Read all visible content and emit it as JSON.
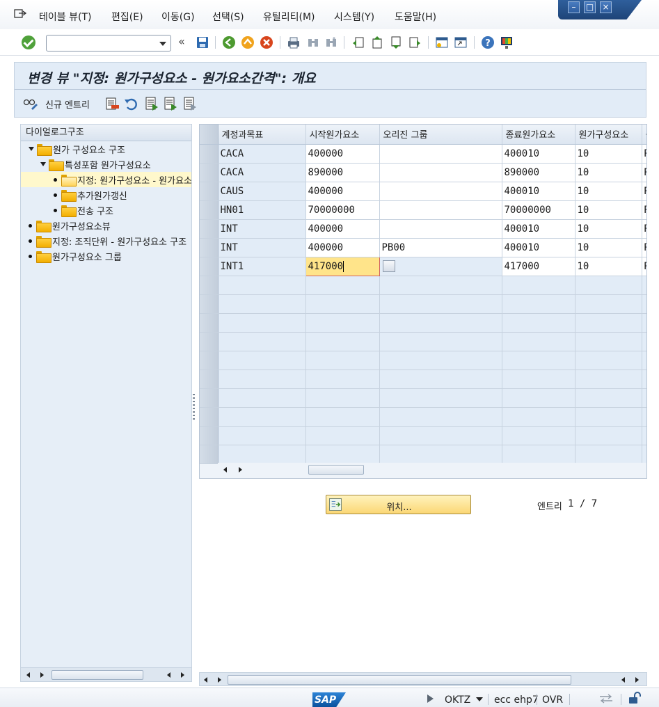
{
  "menu": {
    "items": [
      "테이블 뷰(T)",
      "편집(E)",
      "이동(G)",
      "선택(S)",
      "유틸리티(M)",
      "시스템(Y)",
      "도움말(H)"
    ]
  },
  "window_controls": [
    "minimize",
    "restore",
    "close"
  ],
  "toolbar": {
    "command_value": "",
    "icons": [
      "enter-icon",
      "back-icon",
      "exit-icon",
      "cancel-icon",
      "print-icon",
      "find-icon",
      "find-next-icon",
      "first-page-icon",
      "prev-page-icon",
      "next-page-icon",
      "last-page-icon",
      "new-session-icon",
      "shortcut-icon",
      "help-icon",
      "layout-icon"
    ]
  },
  "title": "변경 뷰 \"지정: 원가구성요소 - 원가요소간격\": 개요",
  "app_toolbar": {
    "new_entries": "신규 엔트리"
  },
  "tree": {
    "header": "다이얼로그구조",
    "nodes": [
      {
        "label": "원가 구성요소 구조",
        "level": 0,
        "type": "expanded"
      },
      {
        "label": "특성포함 원가구성요소",
        "level": 1,
        "type": "expanded"
      },
      {
        "label": "지정: 원가구성요소 - 원가요소간격",
        "level": 2,
        "type": "leaf",
        "selected": true
      },
      {
        "label": "추가원가갱신",
        "level": 2,
        "type": "leaf"
      },
      {
        "label": "전송 구조",
        "level": 2,
        "type": "leaf"
      },
      {
        "label": "원가구성요소뷰",
        "level": 0,
        "type": "leaf"
      },
      {
        "label": "지정: 조직단위 - 원가구성요소 구조",
        "level": 0,
        "type": "leaf"
      },
      {
        "label": "원가구성요소 그룹",
        "level": 0,
        "type": "leaf"
      }
    ]
  },
  "table": {
    "columns": [
      "계정과목표",
      "시작원가요소",
      "오리진 그룹",
      "종료원가요소",
      "원가구성요소",
      "원"
    ],
    "rows": [
      [
        "CACA",
        "400000",
        "",
        "400010",
        "10",
        "R"
      ],
      [
        "CACA",
        "890000",
        "",
        "890000",
        "10",
        "R"
      ],
      [
        "CAUS",
        "400000",
        "",
        "400010",
        "10",
        "R"
      ],
      [
        "HN01",
        "70000000",
        "",
        "70000000",
        "10",
        "R"
      ],
      [
        "INT",
        "400000",
        "",
        "400010",
        "10",
        "R"
      ],
      [
        "INT",
        "400000",
        "PB00",
        "400010",
        "10",
        "R"
      ],
      [
        "INT1",
        "417000",
        "",
        "417000",
        "10",
        "R"
      ]
    ],
    "empty_rows": 10,
    "focus_row": 6
  },
  "position_button": "위치...",
  "entry_label": "엔트리",
  "entry_count": "1 / 7",
  "status": {
    "transaction": "OKTZ",
    "server": "ecc ehp7",
    "mode": "OVR"
  },
  "sap_logo": "SAP"
}
